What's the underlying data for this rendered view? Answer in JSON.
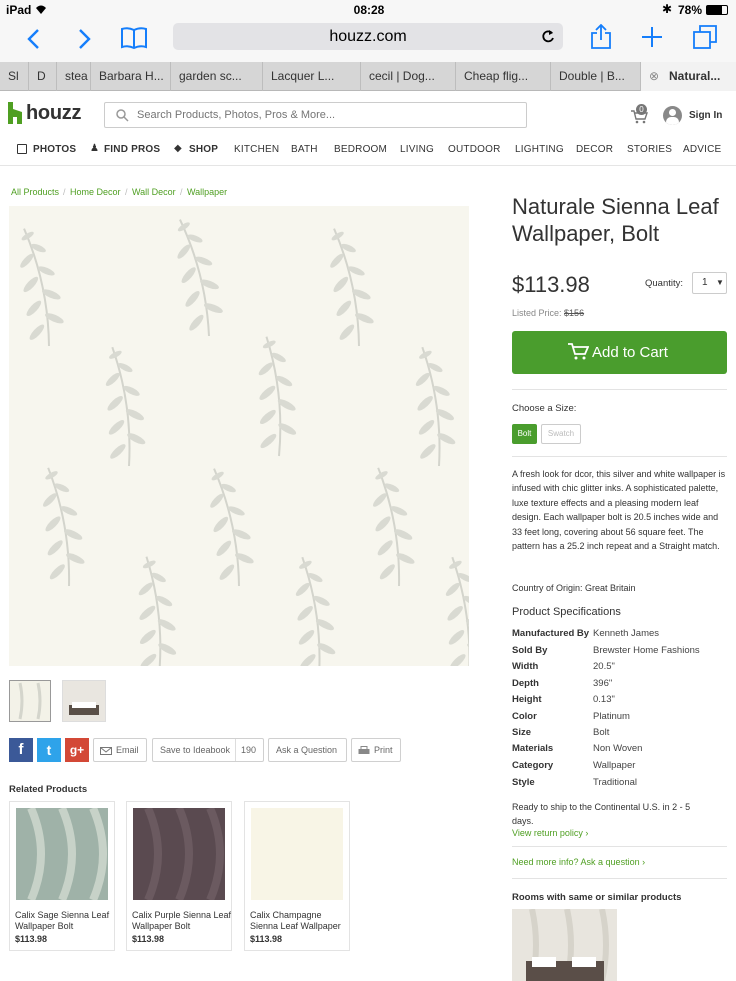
{
  "status_bar": {
    "device": "iPad",
    "time": "08:28",
    "battery": "78%"
  },
  "browser": {
    "url": "houzz.com",
    "tabs": [
      "Sl",
      "D",
      "stea",
      "Barbara H...",
      "garden sc...",
      "Lacquer L...",
      "cecil | Dog...",
      "Cheap flig...",
      "Double | B...",
      "Natural..."
    ]
  },
  "header": {
    "logo": "houzz",
    "search_placeholder": "Search Products, Photos, Pros & More...",
    "cart_count": "0",
    "sign_in": "Sign In"
  },
  "nav": [
    "PHOTOS",
    "FIND PROS",
    "SHOP",
    "KITCHEN",
    "BATH",
    "BEDROOM",
    "LIVING",
    "OUTDOOR",
    "LIGHTING",
    "DECOR",
    "STORIES",
    "ADVICE"
  ],
  "breadcrumb": [
    "All Products",
    "Home Decor",
    "Wall Decor",
    "Wallpaper"
  ],
  "product": {
    "title_line1": "Naturale Sienna Leaf",
    "title_line2": "Wallpaper, Bolt",
    "price": "$113.98",
    "quantity_label": "Quantity:",
    "quantity": "1",
    "listed_label": "Listed Price:",
    "listed_price": "$156",
    "add_to_cart": "Add to Cart",
    "size_label": "Choose a Size:",
    "sizes": [
      "Bolt",
      "Swatch"
    ],
    "description": "A fresh look for dcor, this silver and white wallpaper is infused with chic glitter inks. A sophisticated palette, luxe texture effects and a pleasing modern leaf design. Each wallpaper bolt is 20.5 inches wide and 33 feet long, covering about 56 square feet. The pattern has a 25.2 inch repeat and a Straight match.",
    "origin": "Country of Origin: Great Britain",
    "specs_title": "Product Specifications",
    "specs": [
      {
        "k": "Manufactured By",
        "v": "Kenneth James"
      },
      {
        "k": "Sold By",
        "v": "Brewster Home Fashions"
      },
      {
        "k": "Width",
        "v": "20.5\""
      },
      {
        "k": "Depth",
        "v": "396\""
      },
      {
        "k": "Height",
        "v": "0.13\""
      },
      {
        "k": "Color",
        "v": "Platinum"
      },
      {
        "k": "Size",
        "v": "Bolt"
      },
      {
        "k": "Materials",
        "v": "Non Woven"
      },
      {
        "k": "Category",
        "v": "Wallpaper"
      },
      {
        "k": "Style",
        "v": "Traditional"
      }
    ],
    "ship_line1": "Ready to ship to the Continental U.S. in 2 - 5",
    "ship_line2": "days.",
    "return_policy": "View return policy ›",
    "more_info": "Need more info? Ask a question ›",
    "rooms_title": "Rooms with same or similar products"
  },
  "actions": {
    "email": "Email",
    "ideabook": "Save to Ideabook",
    "ideabook_count": "190",
    "ask": "Ask a Question",
    "print": "Print"
  },
  "related": {
    "title": "Related Products",
    "items": [
      {
        "name": "Calix Sage Sienna Leaf Wallpaper Bolt",
        "price": "$113.98"
      },
      {
        "name": "Calix Purple Sienna Leaf Wallpaper Bolt",
        "price": "$113.98"
      },
      {
        "name": "Calix Champagne Sienna Leaf Wallpaper",
        "price": "$113.98"
      }
    ]
  },
  "colors": {
    "brand_green": "#4f9f22",
    "cart_green": "#4a9d2d",
    "ios_blue": "#157efb"
  }
}
